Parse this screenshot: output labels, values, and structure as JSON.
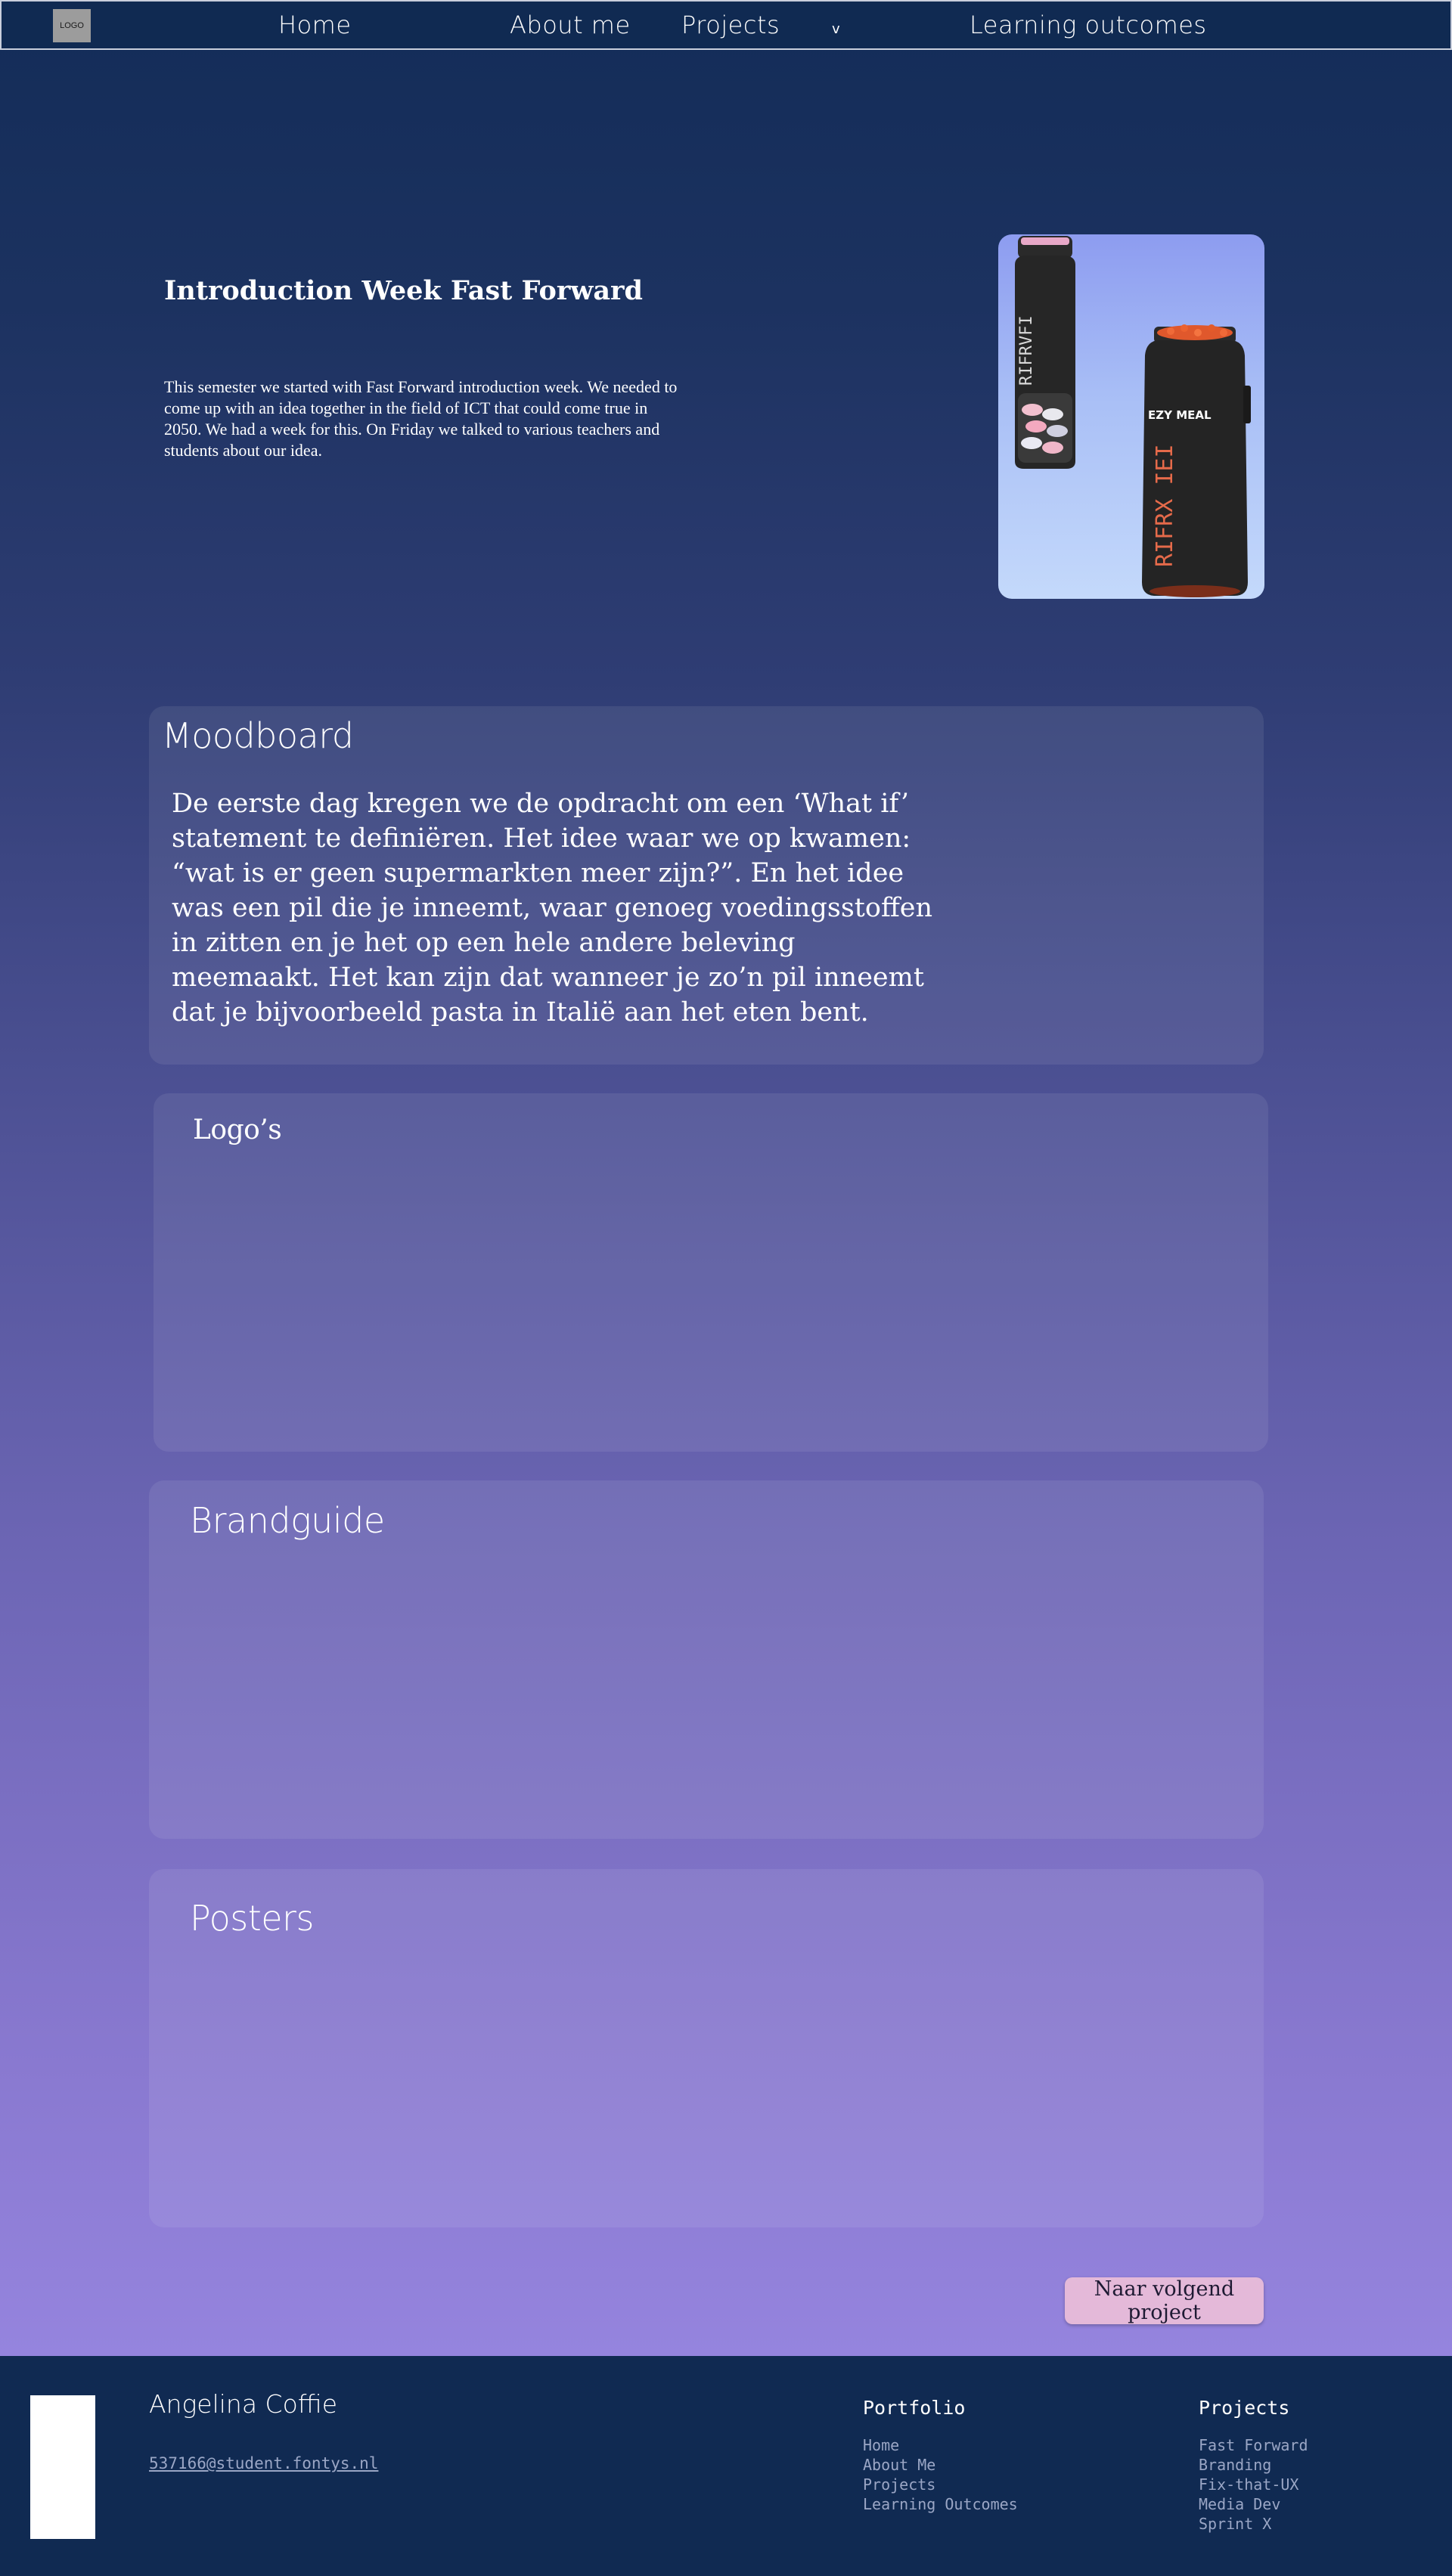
{
  "nav": {
    "logo": "LOGO",
    "home": "Home",
    "about": "About me",
    "projects": "Projects",
    "caret": "v",
    "learning": "Learning outcomes"
  },
  "hero": {
    "title": "Introduction Week Fast Forward",
    "text": "This semester we started with Fast Forward introduction week. We needed to come up with an idea together in the field of ICT that could come true in 2050. We had a week for this. On Friday we talked to various teachers and students about our idea.",
    "bottle_small_label": "RIFRVFI",
    "bottle_large_label": "RIFRX IEI",
    "bottle_large_brand": "EZY MEAL"
  },
  "sections": {
    "moodboard": {
      "title": "Moodboard",
      "text": "De eerste dag kregen we de opdracht om een ‘What if’ statement te definiëren. Het idee waar we op kwamen: “wat is er geen supermarkten meer zijn?”. En het idee was een pil die je inneemt, waar genoeg voedingsstoffen in zitten en je het op een hele andere beleving meemaakt. Het kan zijn dat wanneer je zo’n pil inneemt dat je bijvoorbeeld pasta in Italië aan het eten bent."
    },
    "logos": {
      "title": "Logo’s"
    },
    "brandguide": {
      "title": "Brandguide"
    },
    "posters": {
      "title": "Posters"
    }
  },
  "next_button": "Naar volgend project",
  "footer": {
    "name": "Angelina Coffie",
    "email": "537166@student.fontys.nl",
    "portfolio": {
      "heading": "Portfolio",
      "links": [
        "Home",
        "About Me",
        "Projects",
        "Learning Outcomes"
      ]
    },
    "projects": {
      "heading": "Projects",
      "links": [
        "Fast Forward",
        "Branding",
        "Fix-that-UX",
        "Media Dev",
        "Sprint X"
      ]
    }
  },
  "colors": {
    "nav_bg": "#102a52",
    "button_bg": "#e4b9d9",
    "footer_link": "#9aa6c5"
  }
}
